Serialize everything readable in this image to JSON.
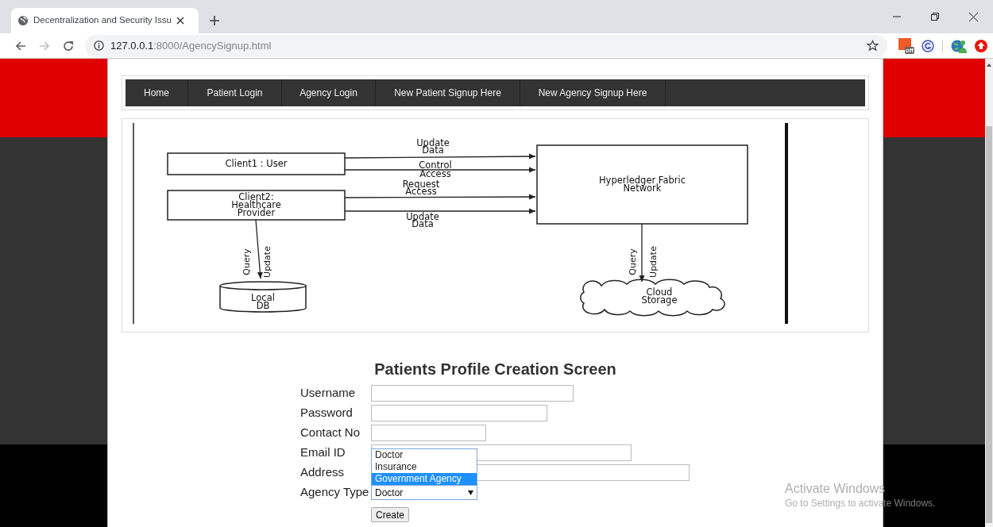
{
  "browser": {
    "tab_title": "Decentralization and Security Issu",
    "url_host": "127.0.0.1",
    "url_rest": ":8000/AgencySignup.html",
    "extension_badge": "off",
    "forward_disabled": true
  },
  "nav": [
    {
      "label": "Home"
    },
    {
      "label": "Patient Login"
    },
    {
      "label": "Agency Login"
    },
    {
      "label": "New Patient Signup Here"
    },
    {
      "label": "New Agency Signup Here"
    }
  ],
  "diagram": {
    "nodes": [
      {
        "kind": "box",
        "lines": [
          "Client1 : User"
        ]
      },
      {
        "kind": "box",
        "lines": [
          "Client2:",
          "Healthcare",
          "Provider"
        ]
      },
      {
        "kind": "box",
        "lines": [
          "Hyperledger Fabric",
          "Network"
        ]
      },
      {
        "kind": "cylinder",
        "lines": [
          "Local",
          "DB"
        ]
      },
      {
        "kind": "cloud",
        "lines": [
          "Cloud",
          "Storage"
        ]
      }
    ],
    "edges": [
      {
        "kind": "horizontal",
        "labels": [
          "Update",
          "Data"
        ]
      },
      {
        "kind": "horizontal",
        "labels": [
          "Control",
          "Access"
        ]
      },
      {
        "kind": "horizontal",
        "labels": [
          "Request",
          "Access"
        ]
      },
      {
        "kind": "horizontal",
        "labels": [
          "Update",
          "Data"
        ]
      },
      {
        "kind": "vertical",
        "labels": [
          "Query",
          "Update"
        ]
      },
      {
        "kind": "vertical",
        "labels": [
          "Query",
          "Update"
        ]
      }
    ]
  },
  "form": {
    "title": "Patients Profile Creation Screen",
    "fields": [
      {
        "label": "Username",
        "kind": "text"
      },
      {
        "label": "Password",
        "kind": "password"
      },
      {
        "label": "Contact No",
        "kind": "text"
      },
      {
        "label": "Email ID",
        "kind": "text"
      },
      {
        "label": "Address",
        "kind": "text"
      },
      {
        "label": "Agency Type",
        "kind": "select",
        "value": "Doctor",
        "expanded": true,
        "options": [
          {
            "label": "Doctor",
            "highlighted": false
          },
          {
            "label": "Insurance",
            "highlighted": false
          },
          {
            "label": "Government Agency",
            "highlighted": true
          }
        ]
      }
    ],
    "button": "Create"
  },
  "os_notice": {
    "title": "Activate Windows",
    "text": "Go to Settings to activate Windows."
  }
}
